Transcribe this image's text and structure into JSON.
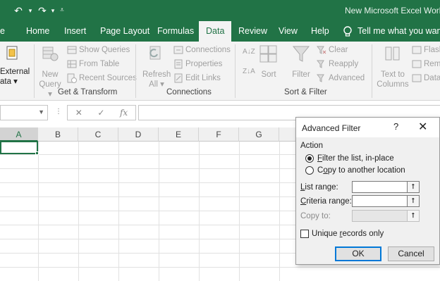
{
  "window": {
    "title": "New Microsoft Excel Worksh",
    "qat": {
      "undo_icon": "undo-icon",
      "redo_icon": "redo-icon",
      "customize_icon": "customize-icon"
    }
  },
  "tabs": [
    {
      "label": "e"
    },
    {
      "label": "Home"
    },
    {
      "label": "Insert"
    },
    {
      "label": "Page Layout"
    },
    {
      "label": "Formulas"
    },
    {
      "label": "Data"
    },
    {
      "label": "Review"
    },
    {
      "label": "View"
    },
    {
      "label": "Help"
    }
  ],
  "tell_me": "Tell me what you want t",
  "ribbon": {
    "external": {
      "line1": "External",
      "line2": "ata ▾"
    },
    "get_transform": {
      "new_query": {
        "line1": "New",
        "line2": "Query ▾"
      },
      "show_queries": "Show Queries",
      "from_table": "From Table",
      "recent_sources": "Recent Sources",
      "group_label": "Get & Transform"
    },
    "connections": {
      "refresh": {
        "line1": "Refresh",
        "line2": "All ▾"
      },
      "connections": "Connections",
      "properties": "Properties",
      "edit_links": "Edit Links",
      "group_label": "Connections"
    },
    "sort_filter": {
      "sort": "Sort",
      "filter": "Filter",
      "clear": "Clear",
      "reapply": "Reapply",
      "advanced": "Advanced",
      "group_label": "Sort & Filter"
    },
    "data_tools": {
      "text_to_columns": {
        "line1": "Text to",
        "line2": "Columns"
      },
      "flash": "Flash",
      "remove": "Remo",
      "data": "Data"
    }
  },
  "formula_bar": {
    "fx": "fx",
    "cancel": "✕",
    "enter": "✓"
  },
  "columns": [
    "A",
    "B",
    "C",
    "D",
    "E",
    "F",
    "G"
  ],
  "dialog": {
    "title": "Advanced Filter",
    "help": "?",
    "close": "✕",
    "action_label": "Action",
    "radio1": {
      "accel": "F",
      "rest": "ilter the list, in-place",
      "selected": true
    },
    "radio2": {
      "pre": "C",
      "accel": "o",
      "rest": "py to another location",
      "selected": false
    },
    "list_range": {
      "accel": "L",
      "rest": "ist range:",
      "value": ""
    },
    "criteria_range": {
      "accel": "C",
      "rest": "riteria range:",
      "value": ""
    },
    "copy_to": {
      "label": "Copy to:",
      "value": ""
    },
    "unique": {
      "pre": "Unique ",
      "accel": "r",
      "rest": "ecords only",
      "checked": false
    },
    "ok": "OK",
    "cancel": "Cancel"
  },
  "colors": {
    "excel_green": "#217346",
    "ribbon_bg": "#f3f3f3",
    "accent_blue": "#0078d7"
  }
}
